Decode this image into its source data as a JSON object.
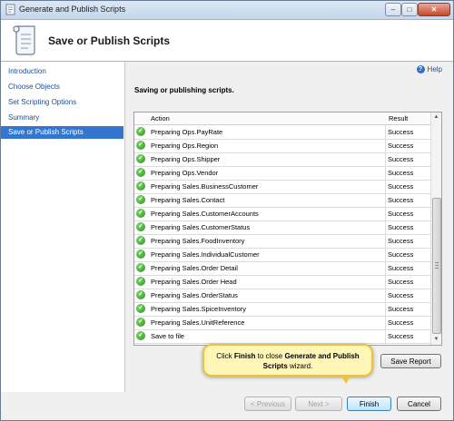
{
  "window": {
    "title": "Generate and Publish Scripts",
    "minimize_label": "–",
    "maximize_label": "□",
    "close_label": "✕"
  },
  "header": {
    "title": "Save or Publish Scripts"
  },
  "sidebar": {
    "items": [
      {
        "label": "Introduction"
      },
      {
        "label": "Choose Objects"
      },
      {
        "label": "Set Scripting Options"
      },
      {
        "label": "Summary"
      },
      {
        "label": "Save or Publish Scripts",
        "active": true
      }
    ]
  },
  "main": {
    "help_label": "Help",
    "help_icon_glyph": "?",
    "status": "Saving or publishing scripts.",
    "columns": {
      "action": "Action",
      "result": "Result"
    },
    "rows": [
      {
        "action": "Preparing Ops.PayRate",
        "result": "Success"
      },
      {
        "action": "Preparing Ops.Region",
        "result": "Success"
      },
      {
        "action": "Preparing Ops.Shipper",
        "result": "Success"
      },
      {
        "action": "Preparing Ops.Vendor",
        "result": "Success"
      },
      {
        "action": "Preparing Sales.BusinessCustomer",
        "result": "Success"
      },
      {
        "action": "Preparing Sales.Contact",
        "result": "Success"
      },
      {
        "action": "Preparing Sales.CustomerAccounts",
        "result": "Success"
      },
      {
        "action": "Preparing Sales.CustomerStatus",
        "result": "Success"
      },
      {
        "action": "Preparing Sales.FoodInventory",
        "result": "Success"
      },
      {
        "action": "Preparing Sales.IndividualCustomer",
        "result": "Success"
      },
      {
        "action": "Preparing Sales.Order Detail",
        "result": "Success"
      },
      {
        "action": "Preparing Sales.Order Head",
        "result": "Success"
      },
      {
        "action": "Preparing Sales.OrderStatus",
        "result": "Success"
      },
      {
        "action": "Preparing Sales.SpiceInventory",
        "result": "Success"
      },
      {
        "action": "Preparing Sales.UnitReference",
        "result": "Success"
      },
      {
        "action": "Save to file",
        "result": "Success"
      }
    ],
    "check_glyph": "✓",
    "save_report_label": "Save Report"
  },
  "callout": {
    "text_prefix": "Click ",
    "finish_word": "Finish",
    "text_middle": " to close ",
    "app_name": "Generate and Publish Scripts",
    "text_suffix": " wizard."
  },
  "footer": {
    "previous_label": "< Previous",
    "next_label": "Next >",
    "finish_label": "Finish",
    "cancel_label": "Cancel"
  },
  "colors": {
    "accent": "#3476cf",
    "link": "#1f4e96",
    "success_green": "#2d8f1f",
    "callout_fill": "#fff6b8",
    "callout_border": "#f0c23a"
  },
  "icons": {
    "app": "scroll-icon",
    "header": "scroll-icon",
    "help": "help-icon",
    "status": "success-check-icon"
  }
}
